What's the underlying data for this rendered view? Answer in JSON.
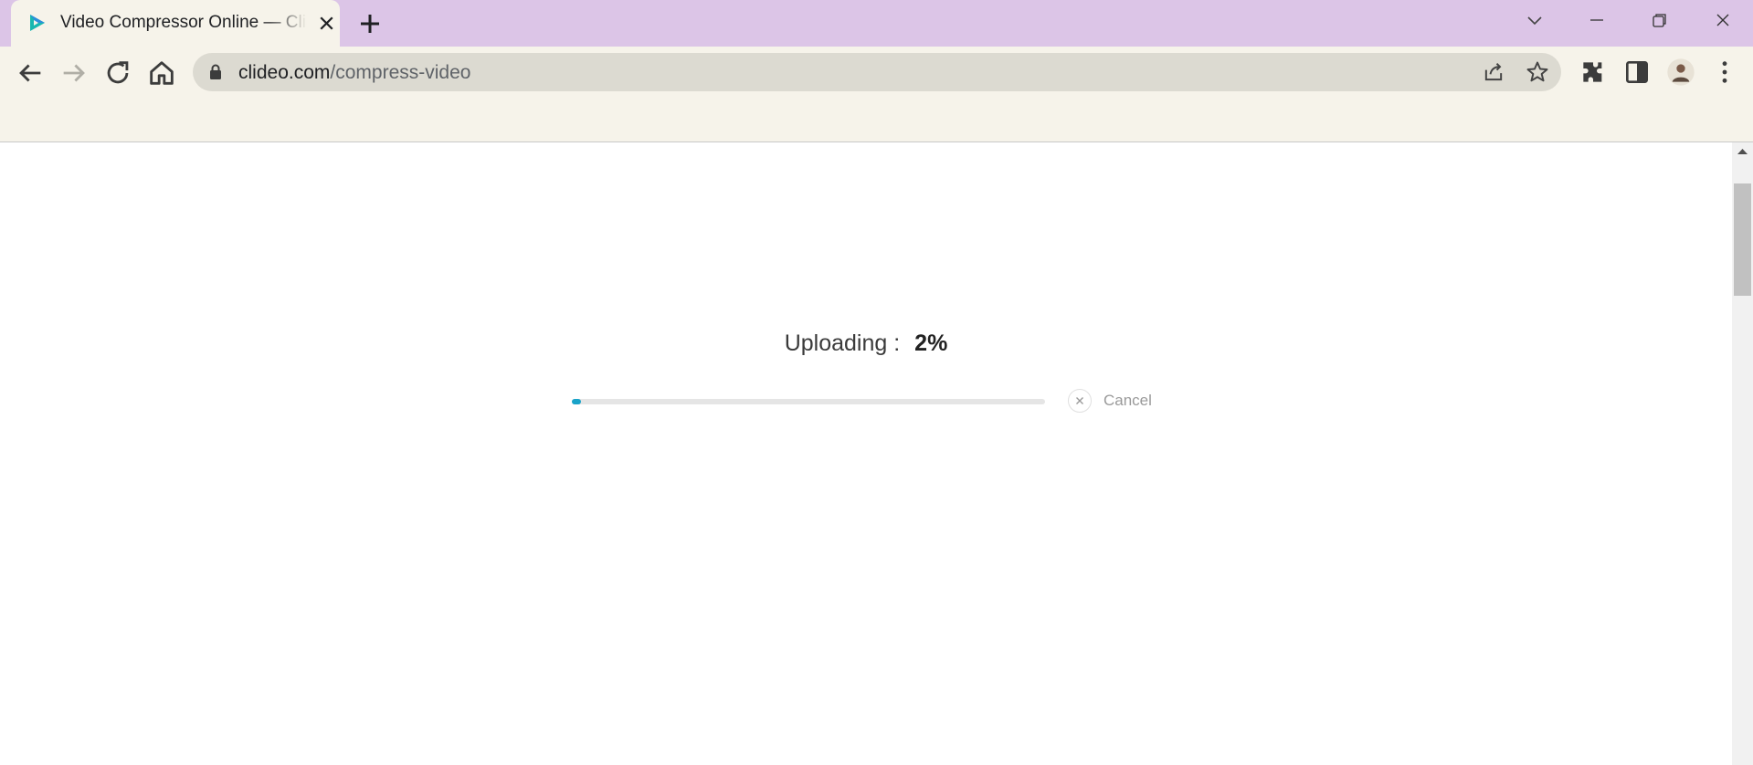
{
  "browser": {
    "tab": {
      "title": "Video Compressor Online — Clideo",
      "favicon": "clideo-play-icon"
    },
    "new_tab": "plus-icon",
    "window_controls": [
      "chevron-down-icon",
      "minimize-icon",
      "restore-icon",
      "close-icon"
    ],
    "address_bar": {
      "domain": "clideo.com",
      "path": "/compress-video"
    },
    "toolbar_icons": [
      "share-icon",
      "star-icon",
      "extensions-icon",
      "side-panel-icon",
      "profile-avatar",
      "menu-icon"
    ]
  },
  "upload": {
    "label": "Uploading :",
    "percent_text": "2%",
    "progress": 0.02,
    "cancel_label": "Cancel"
  },
  "colors": {
    "tabstrip": "#dcc5e7",
    "toolbar": "#f6f3ea",
    "progress_fill": "#1aa3c9",
    "progress_track": "#e5e5e5"
  }
}
